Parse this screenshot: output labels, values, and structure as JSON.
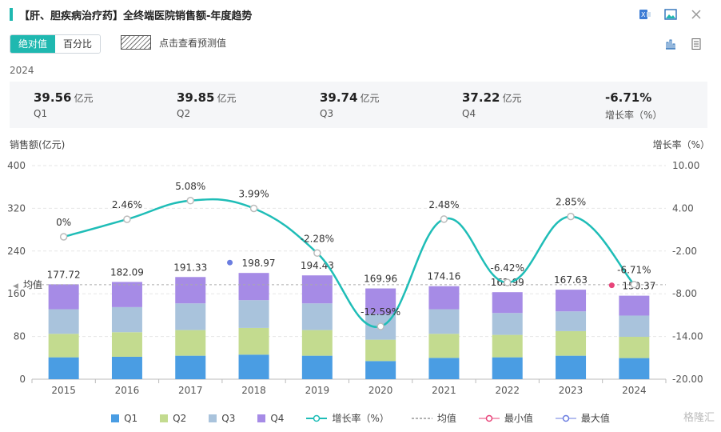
{
  "header": {
    "title": "【肝、胆疾病治疗药】全终端医院销售额-年度趋势"
  },
  "toolbar": {
    "absolute_label": "绝对值",
    "percent_label": "百分比",
    "forecast_label": "点击查看预测值"
  },
  "summary": {
    "year": "2024",
    "items": [
      {
        "value": "39.56",
        "unit": "亿元",
        "label": "Q1"
      },
      {
        "value": "39.85",
        "unit": "亿元",
        "label": "Q2"
      },
      {
        "value": "39.74",
        "unit": "亿元",
        "label": "Q3"
      },
      {
        "value": "37.22",
        "unit": "亿元",
        "label": "Q4"
      },
      {
        "value": "-6.71%",
        "unit": "",
        "label": "增长率（%）"
      }
    ]
  },
  "chart_data": {
    "type": "bar",
    "stacked": true,
    "ylabel": "销售额(亿元)",
    "y2label": "增长率（%）",
    "ylim": [
      0,
      400
    ],
    "y2lim": [
      -20,
      10
    ],
    "yticks": [
      0,
      80,
      160,
      240,
      320,
      400
    ],
    "y2ticks": [
      "10.00",
      "4.00",
      "-2.00",
      "-8.00",
      "-14.00",
      "-20.00"
    ],
    "categories": [
      "2015",
      "2016",
      "2017",
      "2018",
      "2019",
      "2020",
      "2021",
      "2022",
      "2023",
      "2024"
    ],
    "series": [
      {
        "name": "Q1",
        "color": "#4a9de3",
        "values": [
          41,
          42,
          44,
          46,
          44,
          34,
          40,
          41,
          44,
          39.56
        ]
      },
      {
        "name": "Q2",
        "color": "#c3db8f",
        "values": [
          44,
          46,
          48,
          50,
          48,
          40,
          45,
          42,
          46,
          39.85
        ]
      },
      {
        "name": "Q3",
        "color": "#a9c3dc",
        "values": [
          46,
          47,
          50,
          52,
          50,
          48,
          46,
          41,
          37,
          39.74
        ]
      },
      {
        "name": "Q4",
        "color": "#a68be6",
        "values": [
          46.72,
          47.09,
          49.33,
          50.97,
          52.43,
          47.96,
          43.16,
          38.99,
          40.63,
          37.22
        ]
      }
    ],
    "totals": [
      "177.72",
      "182.09",
      "191.33",
      "198.97",
      "194.43",
      "169.96",
      "174.16",
      "162.99",
      "167.63",
      "150.37"
    ],
    "growth": {
      "name": "增长率（%）",
      "color": "#1fbdb7",
      "values": [
        0,
        2.46,
        5.08,
        3.99,
        -2.28,
        -12.59,
        2.48,
        -6.42,
        2.85,
        -6.71
      ],
      "labels": [
        "0%",
        "2.46%",
        "5.08%",
        "3.99%",
        "-2.28%",
        "-12.59%",
        "2.48%",
        "-6.42%",
        "2.85%",
        "-6.71%"
      ]
    },
    "average_label": "均值",
    "average_value": 176.97,
    "max_index": 3,
    "min_index": 9
  },
  "legend": {
    "items": [
      {
        "label": "Q1",
        "color": "#4a9de3"
      },
      {
        "label": "Q2",
        "color": "#c3db8f"
      },
      {
        "label": "Q3",
        "color": "#a9c3dc"
      },
      {
        "label": "Q4",
        "color": "#a68be6"
      },
      {
        "label": "增长率（%）",
        "color": "#1fbdb7"
      },
      {
        "label": "均值",
        "color": "#999999"
      },
      {
        "label": "最小值",
        "color": "#e8447a"
      },
      {
        "label": "最大值",
        "color": "#6b7de0"
      }
    ]
  },
  "watermark": "格隆汇"
}
